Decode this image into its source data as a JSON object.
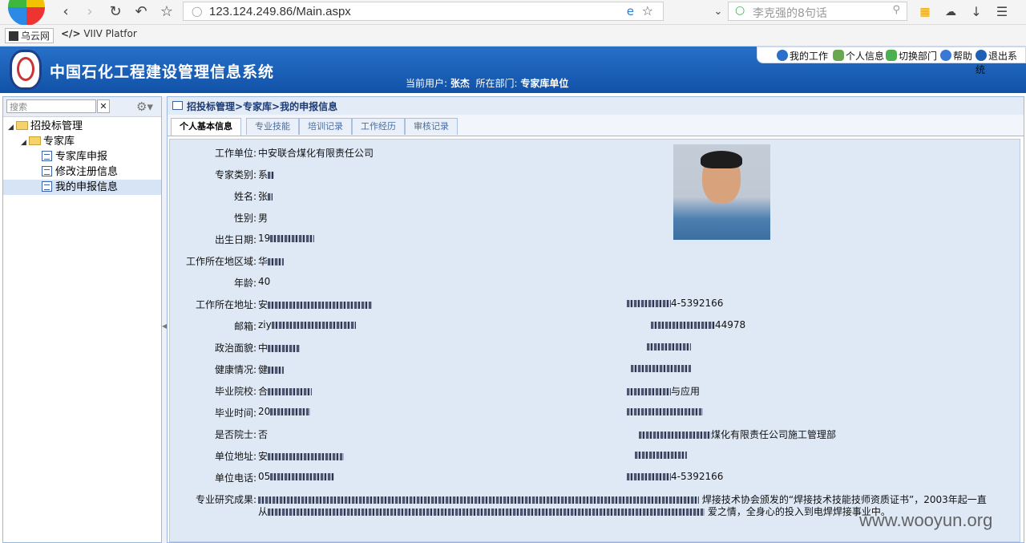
{
  "browser": {
    "url": "123.124.249.86/Main.aspx",
    "search_placeholder": "李克强的8句话",
    "bookmarks": [
      "乌云网",
      "VIIV Platfor"
    ]
  },
  "header": {
    "title": "中国石化工程建设管理信息系统",
    "links": [
      "我的工作",
      "个人信息",
      "切换部门",
      "帮助",
      "退出系统"
    ],
    "current_user_label": "当前用户:",
    "current_user": "张杰",
    "dept_label": "所在部门:",
    "dept": "专家库单位"
  },
  "sidebar": {
    "search_placeholder": "搜索",
    "tree": [
      {
        "label": "招投标管理",
        "type": "folder"
      },
      {
        "label": "专家库",
        "type": "folder"
      },
      {
        "label": "专家库申报",
        "type": "page"
      },
      {
        "label": "修改注册信息",
        "type": "page"
      },
      {
        "label": "我的申报信息",
        "type": "page",
        "selected": true
      }
    ]
  },
  "main": {
    "breadcrumb": "招投标管理>专家库>我的申报信息",
    "tabs": [
      "个人基本信息",
      "专业技能",
      "培训记录",
      "工作经历",
      "审核记录"
    ],
    "active_tab": 0,
    "left_fields": [
      {
        "label": "工作单位:",
        "value": "中安联合煤化有限责任公司"
      },
      {
        "label": "专家类别:",
        "value": "系"
      },
      {
        "label": "姓名:",
        "value": "张"
      },
      {
        "label": "性别:",
        "value": "男"
      },
      {
        "label": "出生日期:",
        "value": "19"
      },
      {
        "label": "工作所在地区域:",
        "value": "华"
      },
      {
        "label": "年龄:",
        "value": "40"
      },
      {
        "label": "工作所在地址:",
        "value": "安"
      },
      {
        "label": "邮箱:",
        "value": "ziy"
      },
      {
        "label": "政治面貌:",
        "value": "中"
      },
      {
        "label": "健康情况:",
        "value": "健"
      },
      {
        "label": "毕业院校:",
        "value": "合"
      },
      {
        "label": "毕业时间:",
        "value": "20"
      },
      {
        "label": "是否院士:",
        "value": "否"
      },
      {
        "label": "单位地址:",
        "value": "安"
      },
      {
        "label": "单位电话:",
        "value": "05"
      }
    ],
    "right_fields": [
      {
        "value": "4-5392166"
      },
      {
        "value": "44978"
      },
      {
        "value": ""
      },
      {
        "value": ""
      },
      {
        "value": "与应用"
      },
      {
        "value": ""
      },
      {
        "value": "煤化有限责任公司施工管理部"
      },
      {
        "value": ""
      },
      {
        "value": "4-5392166"
      }
    ],
    "research_label": "专业研究成果:",
    "research_line1": "焊接技术协会颁发的“焊接技术技能技师资质证书”，2003年起一直",
    "research_line2": "爱之情，全身心的投入到电焊焊接事业中。",
    "research_prefix2": "从"
  },
  "watermark": "www.wooyun.org"
}
